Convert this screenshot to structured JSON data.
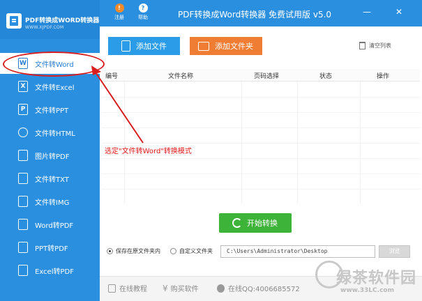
{
  "sidebar": {
    "logo_title": "PDF转换成WORD转换器",
    "logo_url": "WWW.XJPDF.COM",
    "items": [
      {
        "label": "文件转Word",
        "icon": "word-file-icon",
        "glyph": "W",
        "active": true
      },
      {
        "label": "文件转Excel",
        "icon": "excel-file-icon",
        "glyph": "X",
        "active": false
      },
      {
        "label": "文件转PPT",
        "icon": "ppt-file-icon",
        "glyph": "P",
        "active": false
      },
      {
        "label": "文件转HTML",
        "icon": "globe-icon",
        "glyph": "⊕",
        "active": false
      },
      {
        "label": "图片转PDF",
        "icon": "image-pdf-icon",
        "glyph": "",
        "active": false
      },
      {
        "label": "文件转TXT",
        "icon": "txt-file-icon",
        "glyph": "",
        "active": false
      },
      {
        "label": "文件转IMG",
        "icon": "image-icon",
        "glyph": "",
        "active": false
      },
      {
        "label": "Word转PDF",
        "icon": "word-pdf-icon",
        "glyph": "",
        "active": false
      },
      {
        "label": "PPT转PDF",
        "icon": "ppt-pdf-icon",
        "glyph": "",
        "active": false
      },
      {
        "label": "Excel转PDF",
        "icon": "excel-pdf-icon",
        "glyph": "",
        "active": false
      }
    ]
  },
  "topbar": {
    "register_label": "注册",
    "help_label": "帮助",
    "title": "PDF转换成Word转换器 免费试用版 v5.0",
    "minimize": "—",
    "close": "✕"
  },
  "toolbar": {
    "add_file": "添加文件",
    "add_folder": "添加文件夹",
    "clear_list": "清空列表"
  },
  "table": {
    "columns": [
      "编号",
      "文件名称",
      "页码选择",
      "状态",
      "操作"
    ]
  },
  "annotation": "选定\"文件转Word\"转换模式",
  "start_button": "开始转换",
  "save_options": {
    "option_original": "保存在原文件夹内",
    "option_custom": "自定义文件夹",
    "path_value": "C:\\Users\\Administrator\\Desktop",
    "browse": "浏览"
  },
  "bottombar": {
    "tutorial": "在线教程",
    "buy": "购买软件",
    "qq": "在线QQ:4006685572"
  },
  "watermark": {
    "text": "绿茶软件园",
    "url": "www.33LC.com"
  },
  "colors": {
    "sidebar_bg": "#2b8fe0",
    "add_file": "#2b9de8",
    "add_folder": "#f07d34",
    "start": "#3eb33a",
    "annotation_red": "#e01818"
  }
}
